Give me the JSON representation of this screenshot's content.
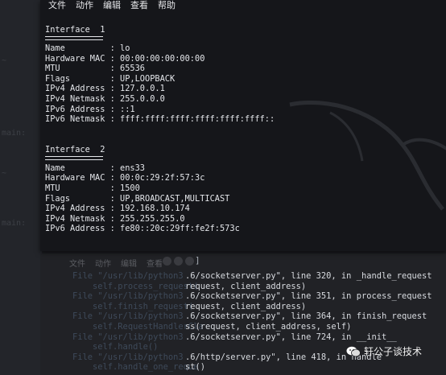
{
  "menu": [
    "文件",
    "动作",
    "编辑",
    "查看",
    "帮助"
  ],
  "interfaces": [
    {
      "title": "Interface  1",
      "fields": [
        {
          "label": "Name         ",
          "value": "lo"
        },
        {
          "label": "Hardware MAC ",
          "value": "00:00:00:00:00:00"
        },
        {
          "label": "MTU          ",
          "value": "65536"
        },
        {
          "label": "Flags        ",
          "value": "UP,LOOPBACK"
        },
        {
          "label": "IPv4 Address ",
          "value": "127.0.0.1"
        },
        {
          "label": "IPv4 Netmask ",
          "value": "255.0.0.0"
        },
        {
          "label": "IPv6 Address ",
          "value": "::1"
        },
        {
          "label": "IPv6 Netmask ",
          "value": "ffff:ffff:ffff:ffff:ffff:ffff::"
        }
      ]
    },
    {
      "title": "Interface  2",
      "fields": [
        {
          "label": "Name         ",
          "value": "ens33"
        },
        {
          "label": "Hardware MAC ",
          "value": "00:0c:29:2f:57:3c"
        },
        {
          "label": "MTU          ",
          "value": "1500"
        },
        {
          "label": "Flags        ",
          "value": "UP,BROADCAST,MULTICAST"
        },
        {
          "label": "IPv4 Address ",
          "value": "192.168.10.174"
        },
        {
          "label": "IPv4 Netmask ",
          "value": "255.255.255.0"
        },
        {
          "label": "IPv6 Address ",
          "value": "fe80::20c:29ff:fe2f:573c"
        }
      ]
    }
  ],
  "back_terminal": {
    "menu": [
      "文件",
      "动作",
      "编辑",
      "查看",
      "帮助"
    ],
    "bracket": "]",
    "lines": [
      {
        "dim": "File \"/usr/lib/python3",
        "text": ".6/socketserver.py\", line 320, in _handle_request"
      },
      {
        "dim": "    self.process_request(",
        "text": "request, client_address)"
      },
      {
        "dim": "File \"/usr/lib/python3",
        "text": ".6/socketserver.py\", line 351, in process_request"
      },
      {
        "dim": "    self.finish_request(",
        "text": "request, client_address)"
      },
      {
        "dim": "File \"/usr/lib/python3",
        "text": ".6/socketserver.py\", line 364, in finish_request"
      },
      {
        "dim": "    self.RequestHandlerCla",
        "text": "ss(request, client_address, self)"
      },
      {
        "dim": "File \"/usr/lib/python3",
        "text": ".6/socketserver.py\", line 724, in __init__"
      },
      {
        "dim": "    self.handle()",
        "text": ""
      },
      {
        "dim": "File \"/usr/lib/python3",
        "text": ".6/http/server.py\", line 418, in handle"
      },
      {
        "dim": "    self.handle_one_reque",
        "text": "st()"
      }
    ]
  },
  "watermark": "轩公子谈技术"
}
